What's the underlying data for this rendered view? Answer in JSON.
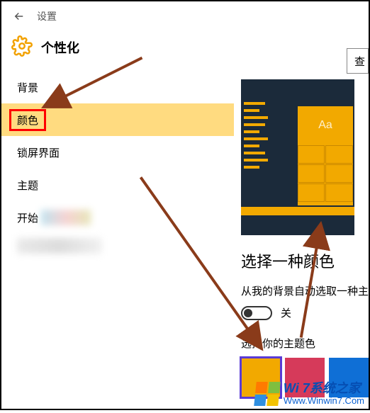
{
  "header": {
    "title": "设置"
  },
  "section": {
    "title": "个性化"
  },
  "top_right_button": "查",
  "sidebar": {
    "items": [
      {
        "label": "背景",
        "selected": false
      },
      {
        "label": "颜色",
        "selected": true
      },
      {
        "label": "锁屏界面",
        "selected": false
      },
      {
        "label": "主题",
        "selected": false
      },
      {
        "label": "开始",
        "selected": false
      }
    ]
  },
  "content": {
    "preview_sample": "Aa",
    "choose_color_title": "选择一种颜色",
    "auto_pick_text": "从我的背景自动选取一种主",
    "toggle_label": "关",
    "theme_color_label": "选择你的主题色",
    "swatches": [
      {
        "color": "#f2a900",
        "selected": true
      },
      {
        "color": "#d63a5a",
        "selected": false
      },
      {
        "color": "#0f6fd6",
        "selected": false
      }
    ]
  },
  "watermark": {
    "line1": "Wi 7系统之家",
    "line2": "Www.Winwin7.Com"
  }
}
